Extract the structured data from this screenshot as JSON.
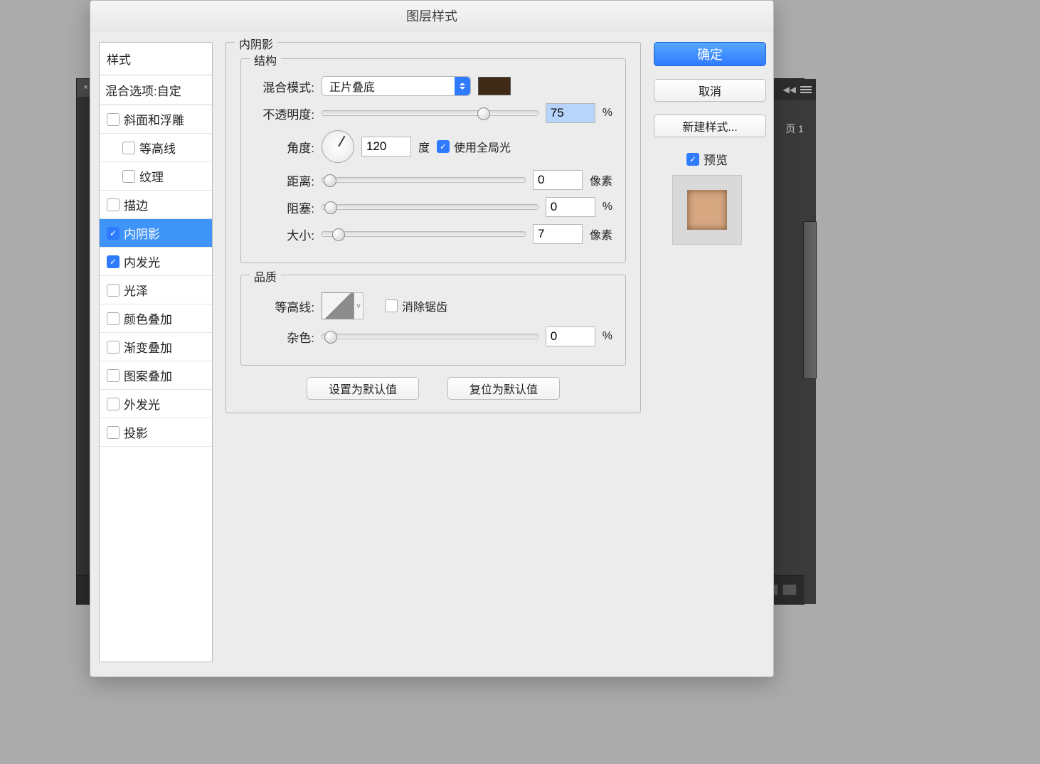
{
  "host": {
    "tab_close": "×",
    "right_label": "页 1"
  },
  "dialog": {
    "title": "图层样式"
  },
  "sidebar": {
    "header": "样式",
    "blend_row": "混合选项:自定",
    "items": [
      {
        "label": "斜面和浮雕",
        "checked": false,
        "indent": false,
        "selected": false
      },
      {
        "label": "等高线",
        "checked": false,
        "indent": true,
        "selected": false
      },
      {
        "label": "纹理",
        "checked": false,
        "indent": true,
        "selected": false
      },
      {
        "label": "描边",
        "checked": false,
        "indent": false,
        "selected": false
      },
      {
        "label": "内阴影",
        "checked": true,
        "indent": false,
        "selected": true
      },
      {
        "label": "内发光",
        "checked": true,
        "indent": false,
        "selected": false
      },
      {
        "label": "光泽",
        "checked": false,
        "indent": false,
        "selected": false
      },
      {
        "label": "颜色叠加",
        "checked": false,
        "indent": false,
        "selected": false
      },
      {
        "label": "渐变叠加",
        "checked": false,
        "indent": false,
        "selected": false
      },
      {
        "label": "图案叠加",
        "checked": false,
        "indent": false,
        "selected": false
      },
      {
        "label": "外发光",
        "checked": false,
        "indent": false,
        "selected": false
      },
      {
        "label": "投影",
        "checked": false,
        "indent": false,
        "selected": false
      }
    ]
  },
  "panel": {
    "section_title": "内阴影",
    "structure_title": "结构",
    "blend_mode_label": "混合模式:",
    "blend_mode_value": "正片叠底",
    "color": "#3f2a16",
    "opacity_label": "不透明度:",
    "opacity_value": "75",
    "opacity_pct": 75,
    "angle_label": "角度:",
    "angle_value": "120",
    "angle_deg_unit": "度",
    "global_light_label": "使用全局光",
    "global_light_checked": true,
    "distance_label": "距离:",
    "distance_value": "0",
    "distance_unit": "像素",
    "choke_label": "阻塞:",
    "choke_value": "0",
    "size_label": "大小:",
    "size_value": "7",
    "size_unit": "像素",
    "quality_title": "品质",
    "contour_label": "等高线:",
    "contour_caret": "v",
    "antialias_label": "消除锯齿",
    "antialias_checked": false,
    "noise_label": "杂色:",
    "noise_value": "0",
    "percent_unit": "%",
    "set_default": "设置为默认值",
    "reset_default": "复位为默认值"
  },
  "right": {
    "ok": "确定",
    "cancel": "取消",
    "new_style": "新建样式...",
    "preview_label": "预览",
    "preview_checked": true
  }
}
